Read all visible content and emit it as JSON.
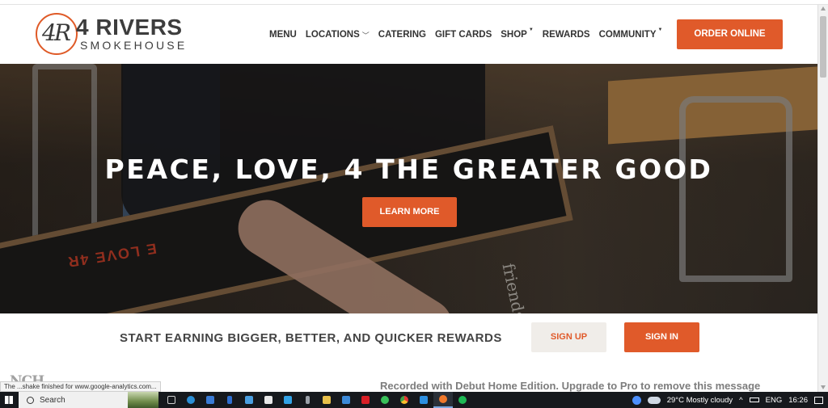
{
  "header": {
    "logo_mark": "4R",
    "logo_name": "4 RIVERS",
    "logo_sub": "SMOKEHOUSE"
  },
  "nav": {
    "items": [
      {
        "label": "MENU"
      },
      {
        "label": "LOCATIONS"
      },
      {
        "label": "CATERING"
      },
      {
        "label": "GIFT CARDS"
      },
      {
        "label": "SHOP"
      },
      {
        "label": "REWARDS"
      },
      {
        "label": "COMMUNITY"
      }
    ],
    "order_label": "ORDER ONLINE",
    "chevron_glyph": "﹀",
    "caret_glyph": "▼"
  },
  "hero": {
    "title": "PEACE, LOVE, 4 THE GREATER GOOD",
    "button_label": "LEARN MORE",
    "table_text": "E LOVE 4R",
    "friends_text": "friends"
  },
  "rewards": {
    "text": "START EARNING BIGGER, BETTER, AND QUICKER REWARDS",
    "signup_label": "SIGN UP",
    "signin_label": "SIGN IN"
  },
  "overlay": {
    "watermark": "Recorded with Debut Home Edition. Upgrade to Pro to remove this message",
    "status_tip": "The ...shake finished for www.google-analytics.com...",
    "corner_logo": "NCH"
  },
  "taskbar": {
    "search_label": "Search",
    "weather": "29°C  Mostly cloudy",
    "language": "ENG",
    "time": "16:26",
    "tray_up": "^"
  },
  "colors": {
    "accent": "#e05a2a",
    "nav_text": "#333333",
    "taskbar": "#16191d"
  }
}
